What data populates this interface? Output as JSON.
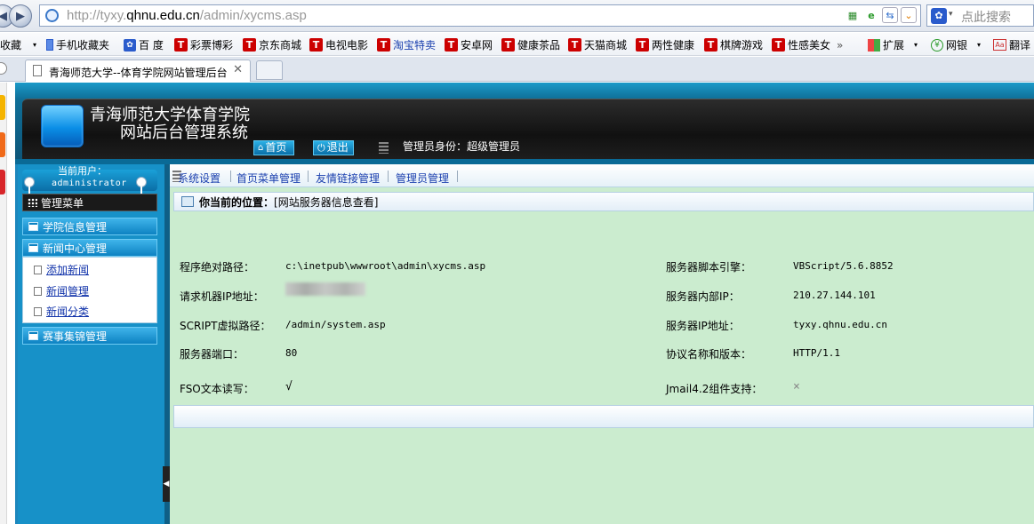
{
  "browser": {
    "url_prefix": "http://tyxy.",
    "url_domain": "qhnu.edu.cn",
    "url_path": "/admin/xycms.asp",
    "search_placeholder": "点此搜索",
    "favorites": [
      {
        "label": "收藏",
        "icon": "dropdown"
      },
      {
        "label": "手机收藏夹",
        "icon": "phone-icon"
      },
      {
        "label": "百 度",
        "icon": "paw-icon"
      },
      {
        "label": "彩票博彩",
        "icon": "t-icon"
      },
      {
        "label": "京东商城",
        "icon": "t-icon"
      },
      {
        "label": "电视电影",
        "icon": "t-icon"
      },
      {
        "label": "淘宝特卖",
        "icon": "t-icon"
      },
      {
        "label": "安卓网",
        "icon": "t-icon"
      },
      {
        "label": "健康茶品",
        "icon": "t-icon"
      },
      {
        "label": "天猫商城",
        "icon": "t-icon"
      },
      {
        "label": "两性健康",
        "icon": "t-icon"
      },
      {
        "label": "棋牌游戏",
        "icon": "t-icon"
      },
      {
        "label": "性感美女",
        "icon": "t-icon"
      },
      {
        "label": "扩展",
        "icon": "grid-icon"
      },
      {
        "label": "网银",
        "icon": "bank-icon"
      },
      {
        "label": "翻译",
        "icon": "translate-icon"
      }
    ],
    "tab_title": "青海师范大学--体育学院网站管理后台"
  },
  "header": {
    "title_line1": "青海师范大学体育学院",
    "title_line2": "网站后台管理系统",
    "home_label": "首页",
    "logout_label": "退出",
    "admin_info": "管理员身份：超级管理员"
  },
  "sidebar": {
    "user_label": "当前用户：",
    "user_name": "administrator",
    "menu_title": "管理菜单",
    "categories": [
      "学院信息管理",
      "新闻中心管理",
      "赛事集锦管理"
    ],
    "sub_items": [
      "添加新闻",
      "新闻管理",
      "新闻分类"
    ]
  },
  "topnav": [
    "系统设置",
    "首页菜单管理",
    "友情链接管理",
    "管理员管理"
  ],
  "location": {
    "label": "你当前的位置：",
    "value": "[网站服务器信息查看]"
  },
  "server_info": {
    "left": [
      {
        "label": "程序绝对路径：",
        "value": "c:\\inetpub\\wwwroot\\admin\\xycms.asp"
      },
      {
        "label": "请求机器IP地址：",
        "value": ""
      },
      {
        "label": "SCRIPT虚拟路径：",
        "value": "/admin/system.asp"
      },
      {
        "label": "服务器端口：",
        "value": "80"
      },
      {
        "label": "FSO文本读写：",
        "value": "√"
      }
    ],
    "right": [
      {
        "label": "服务器脚本引擎：",
        "value": "VBScript/5.6.8852"
      },
      {
        "label": "服务器内部IP：",
        "value": "210.27.144.101"
      },
      {
        "label": "服务器IP地址：",
        "value": "tyxy.qhnu.edu.cn"
      },
      {
        "label": "协议名称和版本：",
        "value": "HTTP/1.1"
      },
      {
        "label": "Jmail4.2组件支持：",
        "value": "×"
      }
    ]
  },
  "colors": {
    "header_blue": "#1c9ac9",
    "main_green": "#cbeccf",
    "link_blue": "#1a3fae"
  }
}
